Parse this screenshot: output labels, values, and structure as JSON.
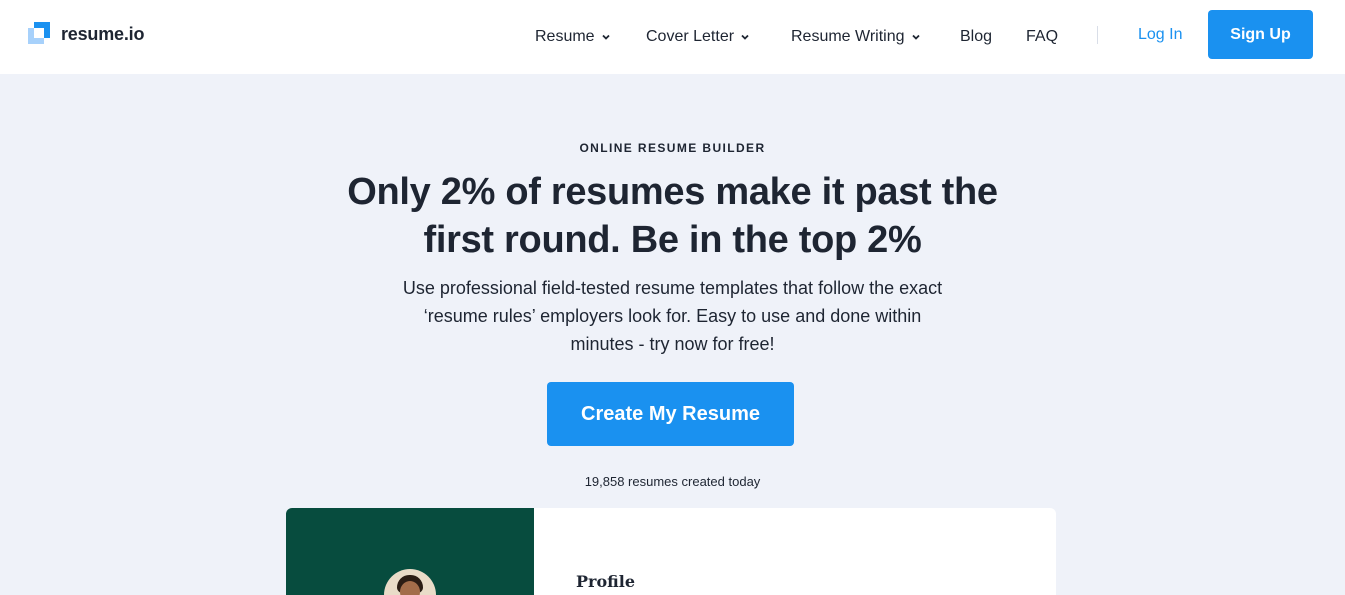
{
  "brand": {
    "name": "resume.io",
    "logo_icon": "resume-logo-icon"
  },
  "nav": {
    "items": [
      {
        "label": "Resume",
        "has_dropdown": true
      },
      {
        "label": "Cover Letter",
        "has_dropdown": true
      },
      {
        "label": "Resume Writing",
        "has_dropdown": true
      },
      {
        "label": "Blog",
        "has_dropdown": false
      },
      {
        "label": "FAQ",
        "has_dropdown": false
      }
    ],
    "login_label": "Log In",
    "signup_label": "Sign Up"
  },
  "hero": {
    "eyebrow": "ONLINE RESUME BUILDER",
    "headline_line1": "Only 2% of resumes make it past the",
    "headline_line2": "first round. Be in the top 2%",
    "subtext_line1": "Use professional field-tested resume templates that follow the exact",
    "subtext_line2": "‘resume rules’ employers look for. Easy to use and done within",
    "subtext_line3": "minutes - try now for free!",
    "cta_label": "Create My Resume",
    "counter_text": "19,858 resumes created today"
  },
  "preview": {
    "section_heading": "Profile"
  },
  "colors": {
    "accent": "#1a91f0",
    "accent_light": "#a7d1fb",
    "page_background": "#eff2f9",
    "text": "#1e2532",
    "preview_sidebar": "#074c3e"
  }
}
